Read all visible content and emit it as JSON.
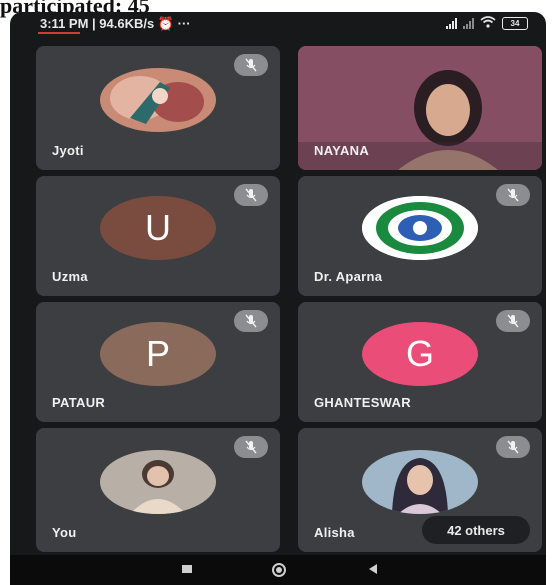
{
  "caption": "participated: 45",
  "status_bar": {
    "time": "3:11 PM | 94.6KB/s",
    "extra": "⏰ ···",
    "battery": "34"
  },
  "tiles": [
    {
      "name": "Jyoti",
      "kind": "photo",
      "muted": true
    },
    {
      "name": "NAYANA",
      "kind": "video",
      "muted": false
    },
    {
      "name": "Uzma",
      "kind": "letter",
      "letter": "U",
      "color": "#7a4c3f",
      "muted": true
    },
    {
      "name": "Dr. Aparna",
      "kind": "logo",
      "muted": true
    },
    {
      "name": "PATAUR",
      "kind": "letter",
      "letter": "P",
      "color": "#8a6a5b",
      "muted": true
    },
    {
      "name": "GHANTESWAR",
      "kind": "letter",
      "letter": "G",
      "color": "#ea4d78",
      "muted": true
    },
    {
      "name": "You",
      "kind": "photo",
      "muted": true
    },
    {
      "name": "Alisha",
      "kind": "photo",
      "muted": true
    }
  ],
  "others_label": "42 others",
  "icons": {
    "mute": "mic-off-icon",
    "nav": [
      "recents-icon",
      "home-icon",
      "back-icon"
    ]
  }
}
